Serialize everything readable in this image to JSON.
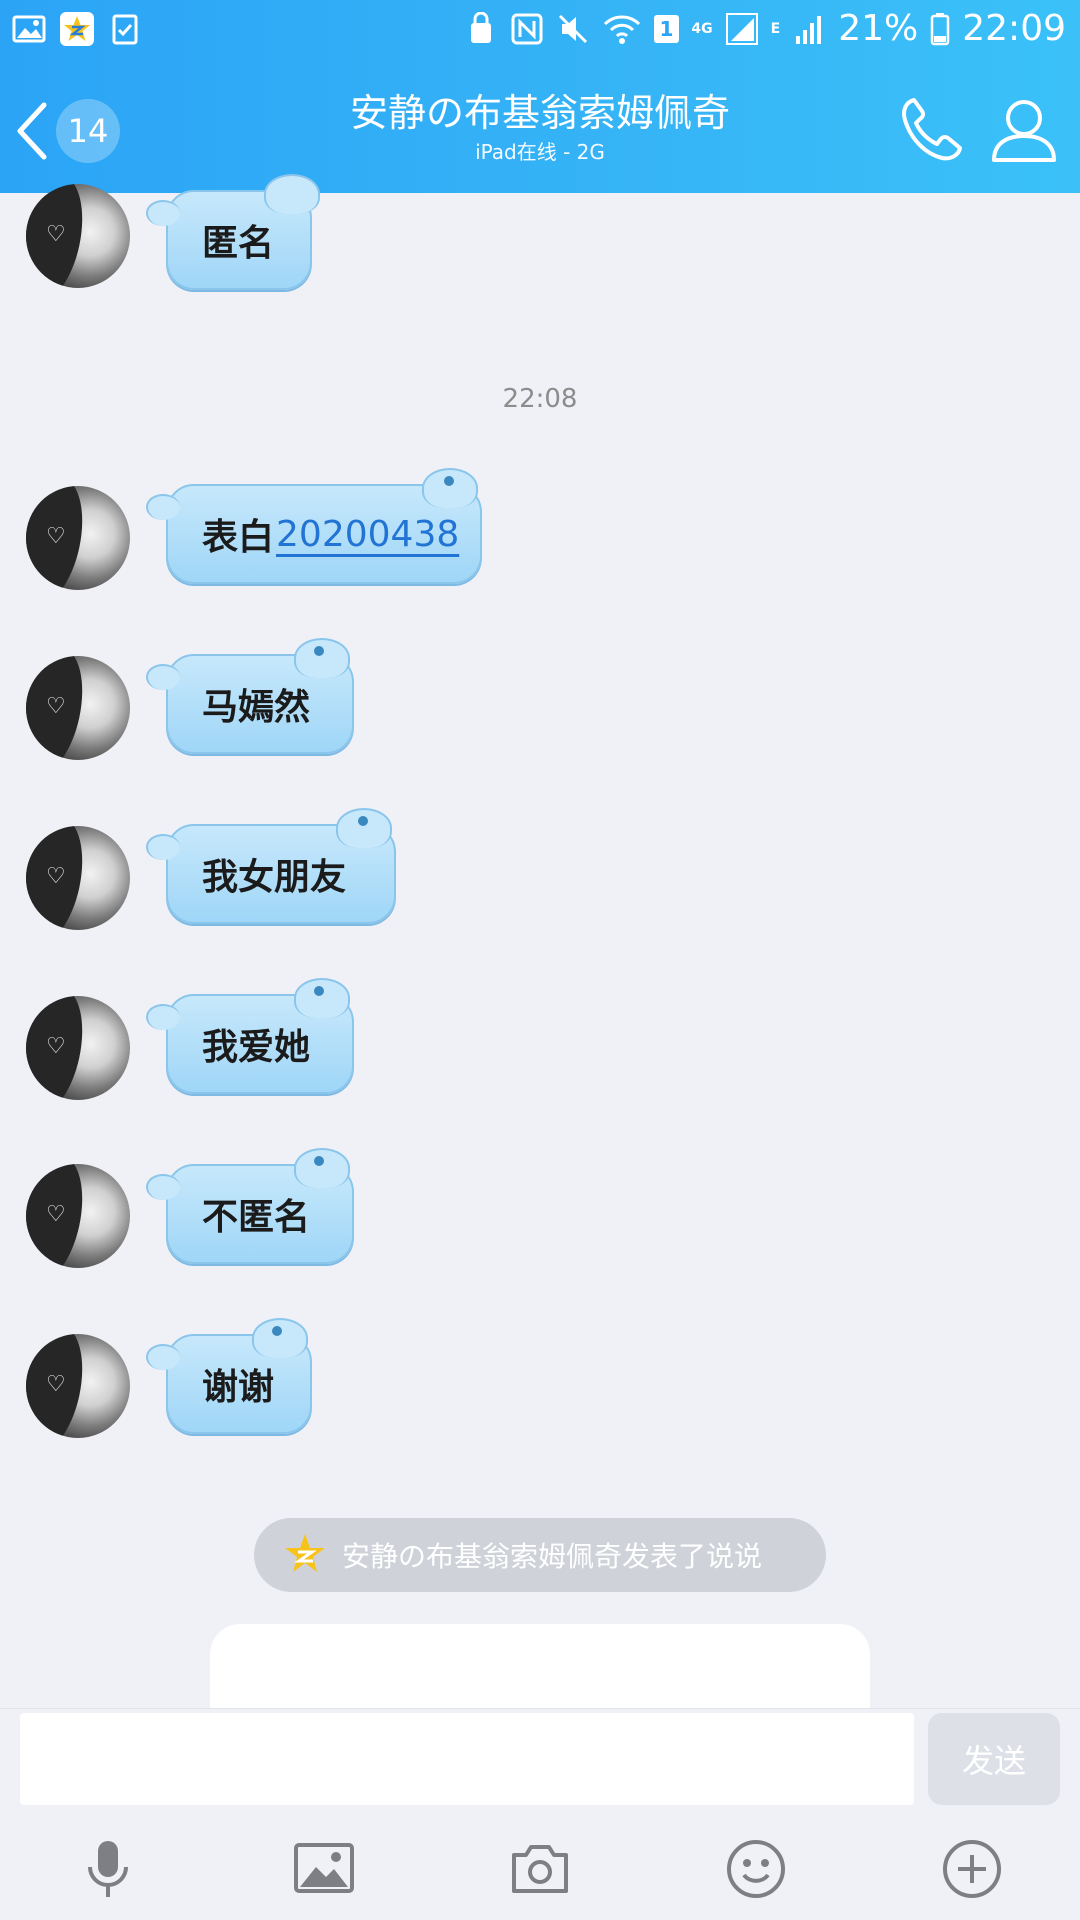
{
  "status_bar": {
    "battery_percent": "21%",
    "time": "22:09",
    "network_4g": "4G",
    "network_e": "E",
    "sim_slot": "1"
  },
  "nav": {
    "back_count": "14",
    "title": "安静の布基翁索姆佩奇",
    "subtitle": "iPad在线 - 2G"
  },
  "messages": {
    "m0": "匿名",
    "timestamp": "22:08",
    "m1_prefix": "表白",
    "m1_link": "20200438",
    "m2": "马嫣然",
    "m3": "我女朋友",
    "m4": "我爱她",
    "m5": "不匿名",
    "m6": "谢谢"
  },
  "system_notice": {
    "text": "安静の布基翁索姆佩奇发表了说说"
  },
  "composer": {
    "input_value": "",
    "send_label": "发送"
  },
  "colors": {
    "header_start": "#2ba4f6",
    "header_end": "#3bc1f8",
    "bubble": "#a8daf8",
    "link": "#2174d4",
    "background": "#eff1f6"
  },
  "icons": {
    "status_left": [
      "gallery-icon",
      "qzone-star-icon",
      "task-checklist-icon"
    ],
    "status_right": [
      "recycle-lock-icon",
      "nfc-icon",
      "mute-icon",
      "wifi-icon",
      "signal-icon",
      "battery-icon"
    ],
    "toolbar": [
      "microphone-icon",
      "image-icon",
      "camera-icon",
      "emoji-icon",
      "plus-icon"
    ]
  }
}
